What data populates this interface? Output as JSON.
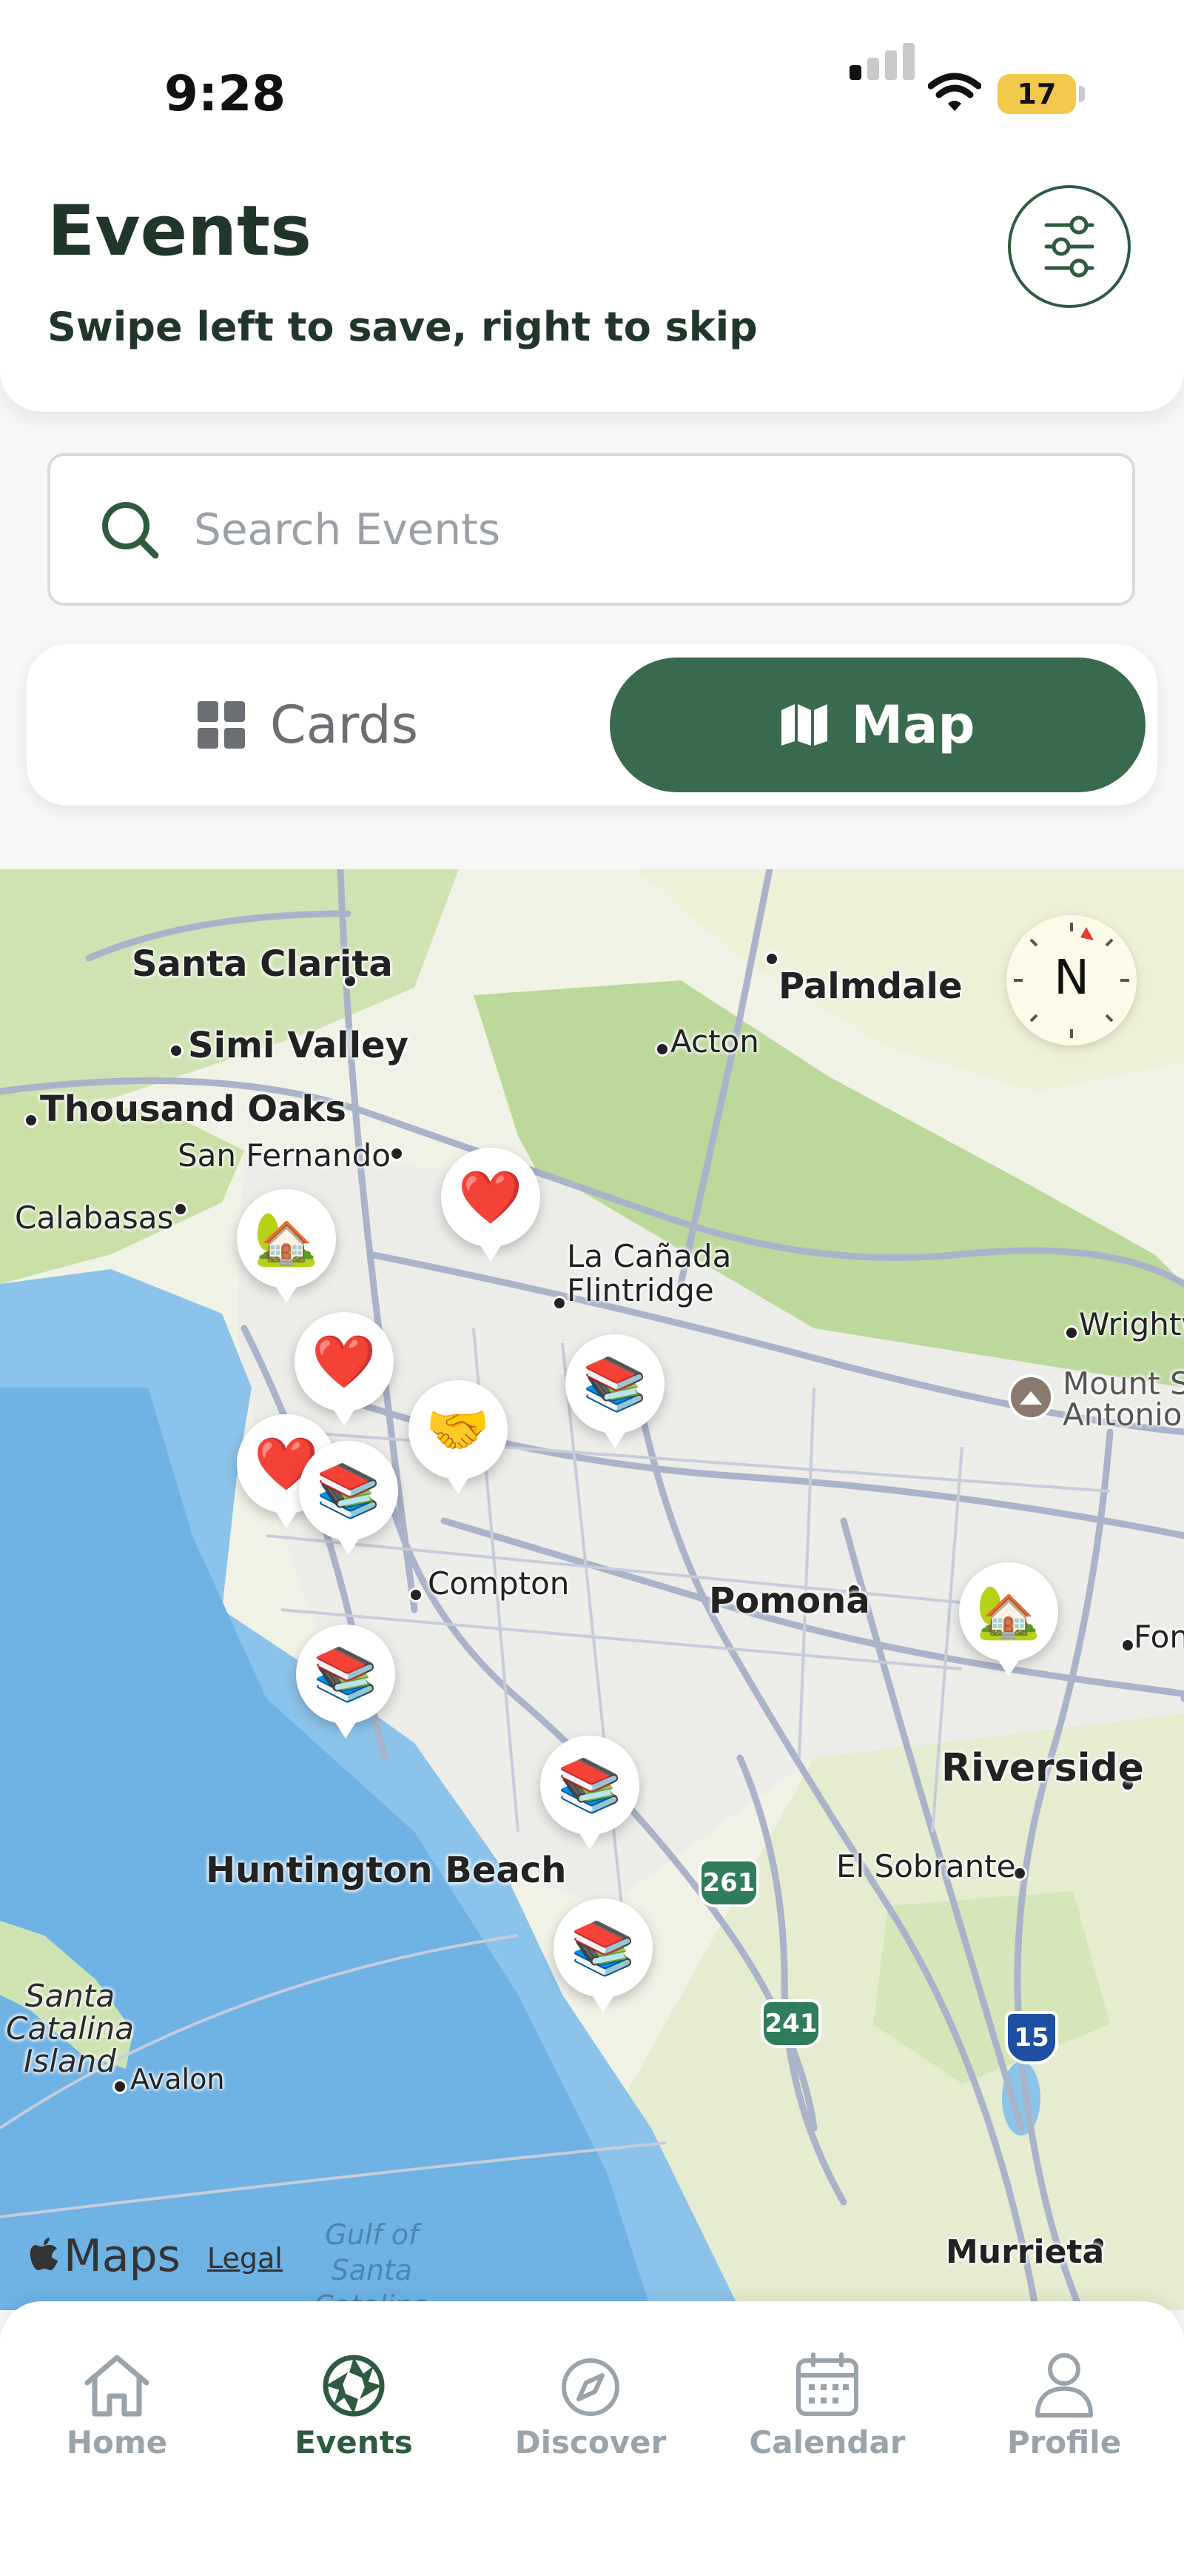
{
  "status_bar": {
    "time": "9:28",
    "battery": "17"
  },
  "header": {
    "title": "Events",
    "subtitle": "Swipe left to save, right to skip",
    "filter_icon": "sliders-icon"
  },
  "search": {
    "placeholder": "Search Events",
    "value": ""
  },
  "view_toggle": {
    "cards_label": "Cards",
    "map_label": "Map",
    "selected": "Map"
  },
  "map": {
    "compass": "N",
    "attribution": "Maps",
    "legal": "Legal",
    "labels": {
      "santa_clarita": "Santa Clarita",
      "palmdale": "Palmdale",
      "simi_valley": "Simi Valley",
      "acton": "Acton",
      "thousand_oaks": "Thousand Oaks",
      "san_fernando": "San Fernando",
      "calabasas": "Calabasas",
      "la_canada": "La Cañada\nFlintridge",
      "wrightwood": "Wrightw",
      "mount_san_antonio": "Mount S\nAntonio",
      "compton": "Compton",
      "pomona": "Pomona",
      "fontana": "Fon",
      "riverside": "Riverside",
      "huntington_beach": "Huntington Beach",
      "el_sobrante": "El Sobrante",
      "santa_catalina": "Santa\nCatalina\nIsland",
      "avalon": "Avalon",
      "gulf": "Gulf of\nSanta\nCatalina",
      "murrieta": "Murrieta"
    },
    "shields": [
      "261",
      "241",
      "15"
    ],
    "pins": [
      {
        "name": "heart",
        "glyph": "❤️"
      },
      {
        "name": "house",
        "glyph": "🏡"
      },
      {
        "name": "heart",
        "glyph": "❤️"
      },
      {
        "name": "books",
        "glyph": "📚"
      },
      {
        "name": "handshake",
        "glyph": "🤝"
      },
      {
        "name": "heart",
        "glyph": "❤️"
      },
      {
        "name": "books",
        "glyph": "📚"
      },
      {
        "name": "house",
        "glyph": "🏡"
      },
      {
        "name": "books",
        "glyph": "📚"
      },
      {
        "name": "books",
        "glyph": "📚"
      },
      {
        "name": "books",
        "glyph": "📚"
      }
    ]
  },
  "tabs": [
    {
      "label": "Home",
      "icon": "home-icon",
      "active": false
    },
    {
      "label": "Events",
      "icon": "aperture-icon",
      "active": true
    },
    {
      "label": "Discover",
      "icon": "compass-icon",
      "active": false
    },
    {
      "label": "Calendar",
      "icon": "calendar-icon",
      "active": false
    },
    {
      "label": "Profile",
      "icon": "person-icon",
      "active": false
    }
  ],
  "colors": {
    "brand_green": "#3a6a4d",
    "title_green": "#20362a",
    "inactive_tab": "#9aa3aa"
  }
}
